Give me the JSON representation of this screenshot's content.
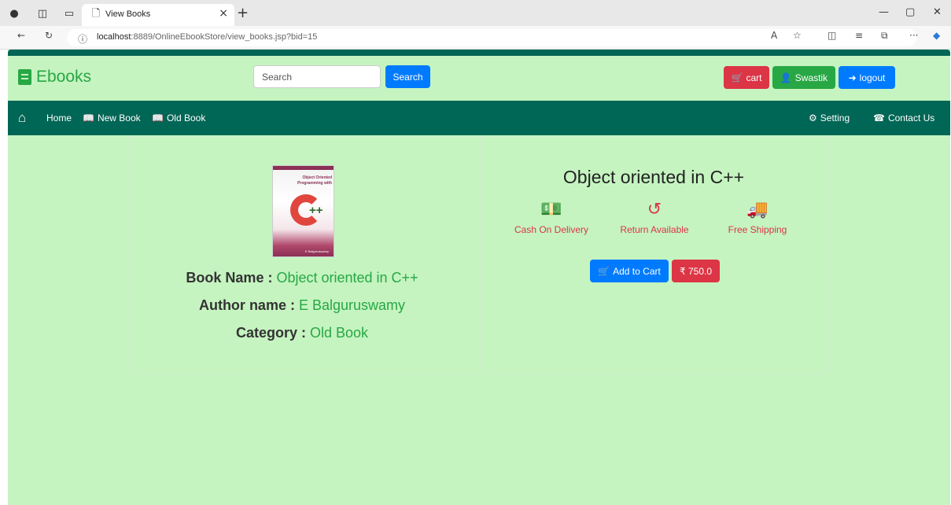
{
  "browser": {
    "tab_title": "View Books",
    "url_host": "localhost",
    "url_path": ":8889/OnlineEbookStore/view_books.jsp?bid=15"
  },
  "header": {
    "logo_text": "Ebooks",
    "search_placeholder": "Search",
    "search_button": "Search",
    "cart_button": "cart",
    "user_button": "Swastik",
    "logout_button": "logout"
  },
  "nav": {
    "home": "Home",
    "new_book": "New Book",
    "old_book": "Old Book",
    "setting": "Setting",
    "contact": "Contact Us"
  },
  "book": {
    "cover_title": "Object Oriented Programming with",
    "cover_symbol": "++",
    "cover_author": "E Balguruswamy",
    "name_label": "Book Name :",
    "name_value": "Object oriented in C++",
    "author_label": "Author name :",
    "author_value": "E Balguruswamy",
    "category_label": "Category :",
    "category_value": "Old Book",
    "title": "Object oriented in C++"
  },
  "features": [
    {
      "label": "Cash On Delivery",
      "icon": "money-icon"
    },
    {
      "label": "Return Available",
      "icon": "undo-icon"
    },
    {
      "label": "Free Shipping",
      "icon": "truck-icon"
    }
  ],
  "actions": {
    "add_to_cart": "Add to Cart",
    "price": "₹ 750.0"
  },
  "colors": {
    "page_bg": "#c5f4c0",
    "nav_bg": "#006655",
    "accent_green": "#28a745",
    "danger": "#dc3545",
    "primary": "#007bff"
  }
}
